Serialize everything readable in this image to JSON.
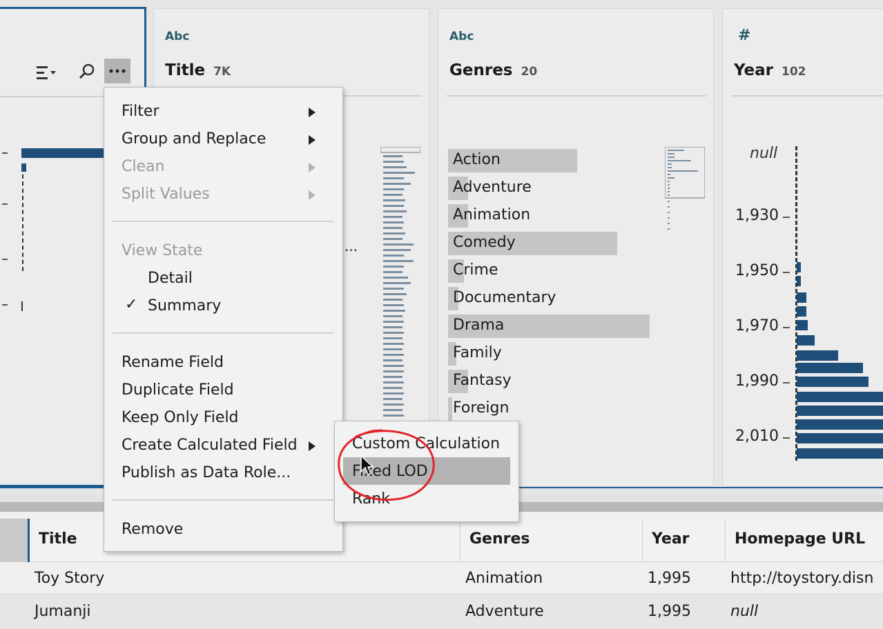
{
  "colors": {
    "accent": "#1f4e79",
    "selection": "#1d5a8e",
    "annotation": "#e0262b"
  },
  "left_card": {
    "sort_icon": "sort-icon",
    "search_icon": "search-icon",
    "more_icon": "more-options-icon"
  },
  "title_card": {
    "type": "Abc",
    "name": "Title",
    "count": "7K",
    "truncated": "..."
  },
  "genres_card": {
    "type": "Abc",
    "name": "Genres",
    "count": "20",
    "items": [
      {
        "label": "Action",
        "value": 0.64
      },
      {
        "label": "Adventure",
        "value": 0.1
      },
      {
        "label": "Animation",
        "value": 0.1
      },
      {
        "label": "Comedy",
        "value": 0.84
      },
      {
        "label": "Crime",
        "value": 0.08
      },
      {
        "label": "Documentary",
        "value": 0.05
      },
      {
        "label": "Drama",
        "value": 1.0
      },
      {
        "label": "Family",
        "value": 0.04
      },
      {
        "label": "Fantasy",
        "value": 0.1
      },
      {
        "label": "Foreign",
        "value": 0.02
      }
    ]
  },
  "year_card": {
    "type": "#",
    "name": "Year",
    "count": "102",
    "null_label": "null",
    "ticks": [
      "1,930",
      "1,950",
      "1,970",
      "1,990",
      "2,010"
    ]
  },
  "context_menu": {
    "filter": "Filter",
    "group_replace": "Group and Replace",
    "clean": "Clean",
    "split_values": "Split Values",
    "view_state": "View State",
    "detail": "Detail",
    "summary": "Summary",
    "check": "✓",
    "rename": "Rename Field",
    "duplicate": "Duplicate Field",
    "keep_only": "Keep Only Field",
    "create_calc": "Create Calculated Field",
    "publish": "Publish as Data Role...",
    "remove": "Remove"
  },
  "submenu": {
    "custom_calc": "Custom Calculation",
    "fixed_lod": "Fixed LOD",
    "rank": "Rank"
  },
  "grid": {
    "headers": [
      "Title",
      "Genres",
      "Year",
      "Homepage URL"
    ],
    "rows": [
      {
        "title": "Toy Story",
        "genres": "Animation",
        "year": "1,995",
        "url": "http://toystory.disn"
      },
      {
        "title": "Jumanji",
        "genres": "Adventure",
        "year": "1,995",
        "url": "null"
      }
    ]
  }
}
